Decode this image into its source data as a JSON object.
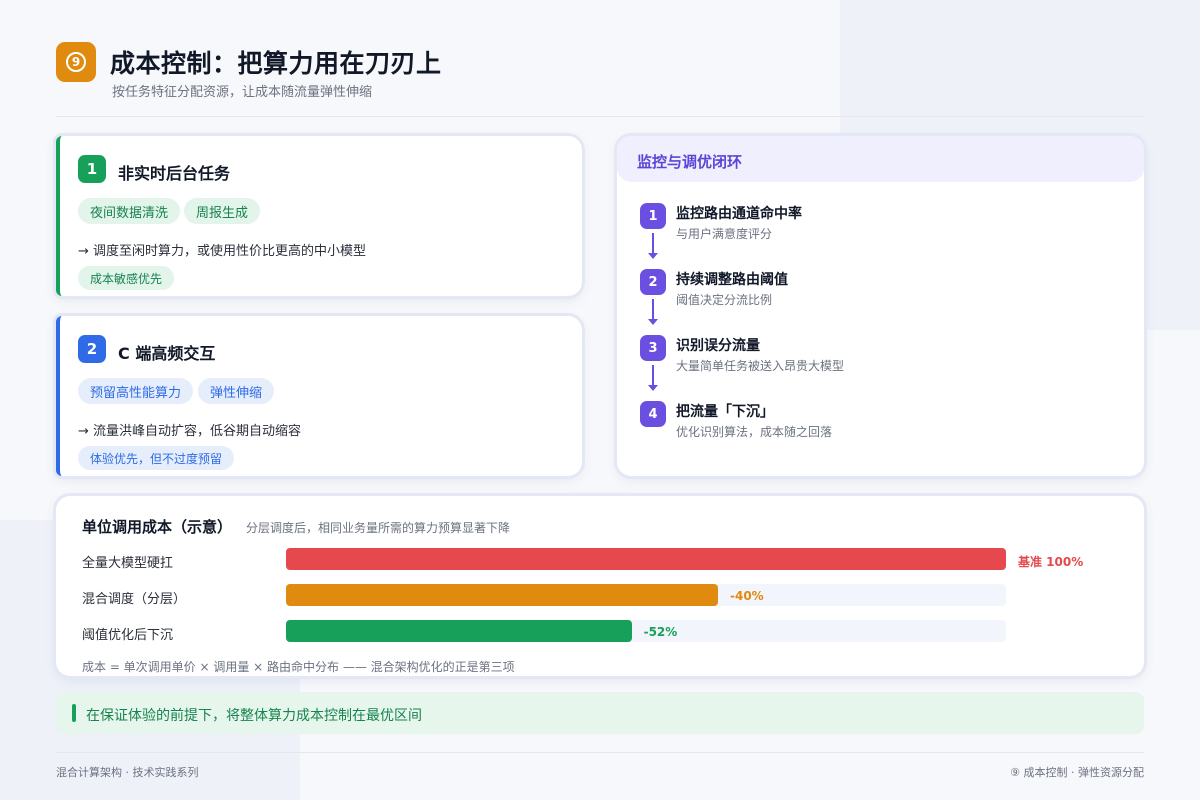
{
  "header": {
    "badge": "9",
    "title": "成本控制：把算力用在刀刃上",
    "subtitle": "按任务特征分配资源，让成本随流量弹性伸缩"
  },
  "cards": [
    {
      "num": "1",
      "title": "非实时后台任务",
      "chips": [
        "夜间数据清洗",
        "周报生成"
      ],
      "desc": "→ 调度至闲时算力，或使用性价比更高的中小模型",
      "tag": "成本敏感优先",
      "color": "#16a05a"
    },
    {
      "num": "2",
      "title": "C 端高频交互",
      "chips": [
        "预留高性能算力",
        "弹性伸缩"
      ],
      "desc": "→ 流量洪峰自动扩容，低谷期自动缩容",
      "tag": "体验优先，但不过度预留",
      "color": "#2f6be6"
    }
  ],
  "monitor": {
    "title": "监控与调优闭环",
    "steps": [
      {
        "num": "1",
        "title": "监控路由通道命中率",
        "sub": "与用户满意度评分"
      },
      {
        "num": "2",
        "title": "持续调整路由阈值",
        "sub": "阈值决定分流比例"
      },
      {
        "num": "3",
        "title": "识别误分流量",
        "sub": "大量简单任务被送入昂贵大模型"
      },
      {
        "num": "4",
        "title": "把流量「下沉」",
        "sub": "优化识别算法，成本随之回落"
      }
    ]
  },
  "cost": {
    "title": "单位调用成本（示意）",
    "subtitle": "分层调度后，相同业务量所需的算力预算显著下降",
    "rows": [
      {
        "label": "全量大模型硬扛",
        "fraction": 1.0,
        "value_label": "基准 100%",
        "color": "#e5484d"
      },
      {
        "label": "混合调度（分层）",
        "fraction": 0.6,
        "value_label": "-40%",
        "color": "#e08a10"
      },
      {
        "label": "阈值优化后下沉",
        "fraction": 0.48,
        "value_label": "-52%",
        "color": "#16a05a"
      }
    ],
    "formula": "成本 = 单次调用单价 × 调用量 × 路由命中分布 —— 混合架构优化的正是第三项"
  },
  "callout": "在保证体验的前提下，将整体算力成本控制在最优区间",
  "footer": {
    "left": "混合计算架构 · 技术实践系列",
    "right": "⑨ 成本控制 · 弹性资源分配"
  }
}
